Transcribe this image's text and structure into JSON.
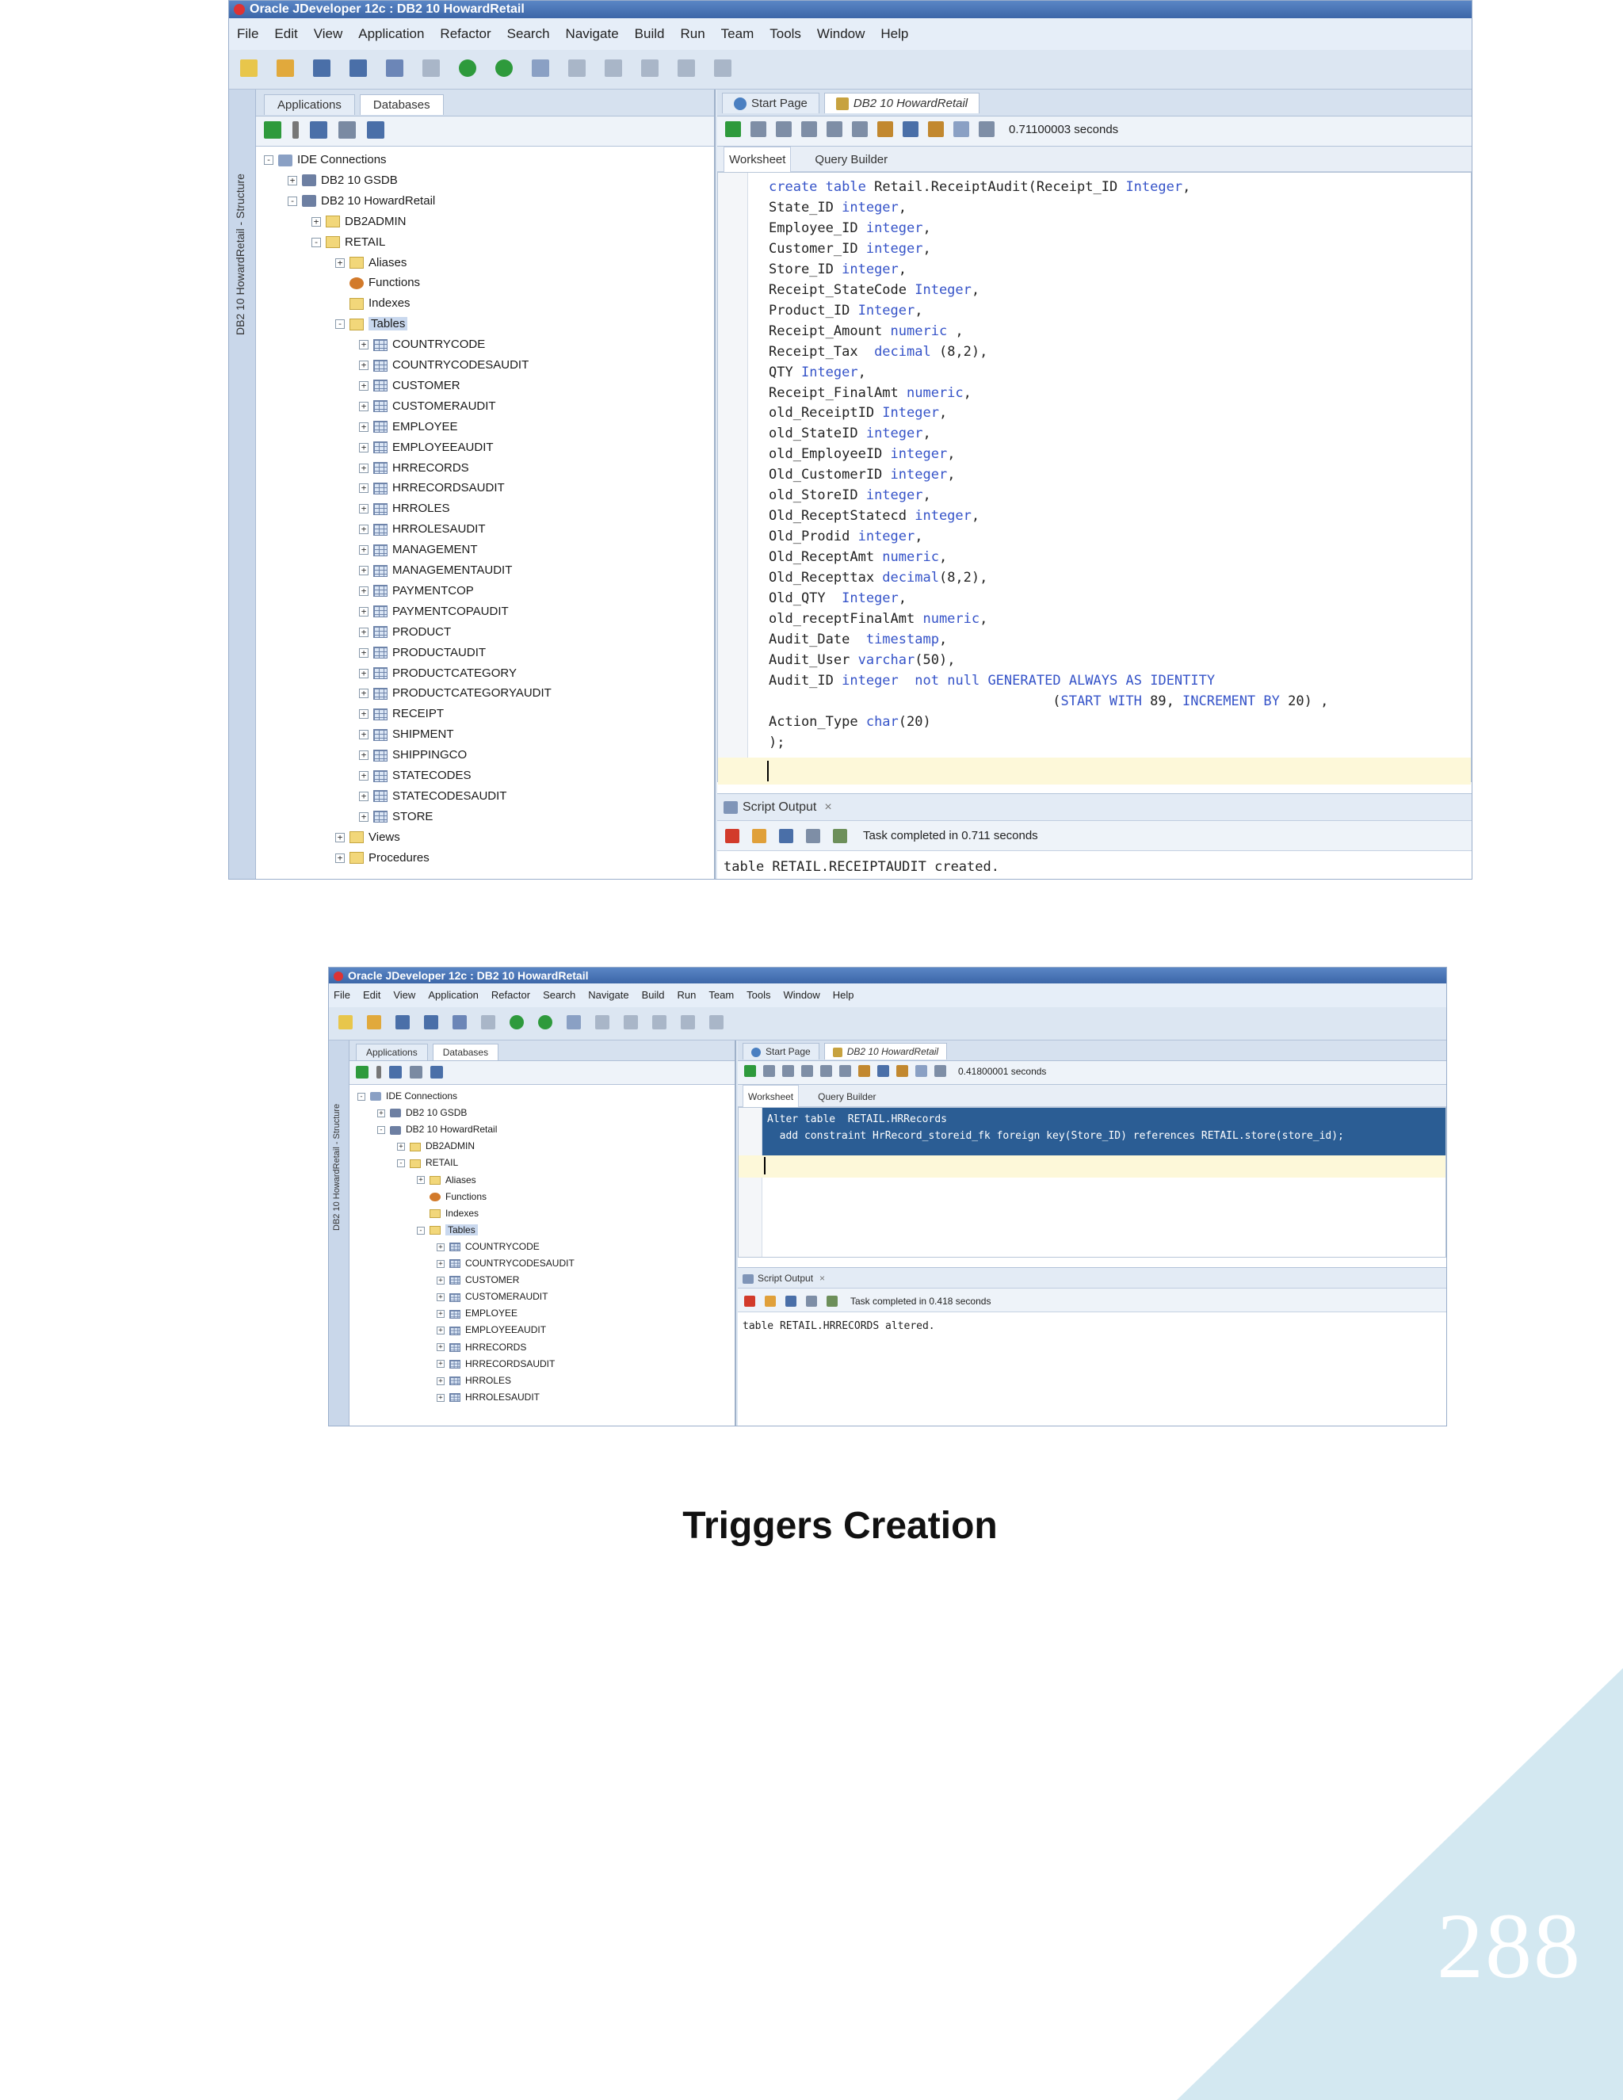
{
  "page": {
    "caption": "Triggers Creation",
    "page_number": "288",
    "corner_color": "#d3e8f1"
  },
  "shot1": {
    "title": "Oracle JDeveloper 12c : DB2 10 HowardRetail",
    "menu": [
      "File",
      "Edit",
      "View",
      "Application",
      "Refactor",
      "Search",
      "Navigate",
      "Build",
      "Run",
      "Team",
      "Tools",
      "Window",
      "Help"
    ],
    "left_tabs": [
      "Applications",
      "Databases"
    ],
    "structure_label": "DB2 10 HowardRetail - Structure",
    "tree": [
      {
        "label": "IDE Connections",
        "level": 0,
        "icon": "conn",
        "expander": "-"
      },
      {
        "label": "DB2 10 GSDB",
        "level": 1,
        "icon": "db",
        "expander": "+"
      },
      {
        "label": "DB2 10 HowardRetail",
        "level": 1,
        "icon": "db",
        "expander": "-"
      },
      {
        "label": "DB2ADMIN",
        "level": 2,
        "icon": "folder",
        "expander": "+"
      },
      {
        "label": "RETAIL",
        "level": 2,
        "icon": "folder",
        "expander": "-"
      },
      {
        "label": "Aliases",
        "level": 3,
        "icon": "folder",
        "expander": "+"
      },
      {
        "label": "Functions",
        "level": 3,
        "icon": "func",
        "expander": ""
      },
      {
        "label": "Indexes",
        "level": 3,
        "icon": "folder",
        "expander": ""
      },
      {
        "label": "Tables",
        "level": 3,
        "icon": "folder",
        "expander": "-",
        "selected": true
      },
      {
        "label": "COUNTRYCODE",
        "level": 4,
        "icon": "table",
        "expander": "+"
      },
      {
        "label": "COUNTRYCODESAUDIT",
        "level": 4,
        "icon": "table",
        "expander": "+"
      },
      {
        "label": "CUSTOMER",
        "level": 4,
        "icon": "table",
        "expander": "+"
      },
      {
        "label": "CUSTOMERAUDIT",
        "level": 4,
        "icon": "table",
        "expander": "+"
      },
      {
        "label": "EMPLOYEE",
        "level": 4,
        "icon": "table",
        "expander": "+"
      },
      {
        "label": "EMPLOYEEAUDIT",
        "level": 4,
        "icon": "table",
        "expander": "+"
      },
      {
        "label": "HRRECORDS",
        "level": 4,
        "icon": "table",
        "expander": "+"
      },
      {
        "label": "HRRECORDSAUDIT",
        "level": 4,
        "icon": "table",
        "expander": "+"
      },
      {
        "label": "HRROLES",
        "level": 4,
        "icon": "table",
        "expander": "+"
      },
      {
        "label": "HRROLESAUDIT",
        "level": 4,
        "icon": "table",
        "expander": "+"
      },
      {
        "label": "MANAGEMENT",
        "level": 4,
        "icon": "table",
        "expander": "+"
      },
      {
        "label": "MANAGEMENTAUDIT",
        "level": 4,
        "icon": "table",
        "expander": "+"
      },
      {
        "label": "PAYMENTCOP",
        "level": 4,
        "icon": "table",
        "expander": "+"
      },
      {
        "label": "PAYMENTCOPAUDIT",
        "level": 4,
        "icon": "table",
        "expander": "+"
      },
      {
        "label": "PRODUCT",
        "level": 4,
        "icon": "table",
        "expander": "+"
      },
      {
        "label": "PRODUCTAUDIT",
        "level": 4,
        "icon": "table",
        "expander": "+"
      },
      {
        "label": "PRODUCTCATEGORY",
        "level": 4,
        "icon": "table",
        "expander": "+"
      },
      {
        "label": "PRODUCTCATEGORYAUDIT",
        "level": 4,
        "icon": "table",
        "expander": "+"
      },
      {
        "label": "RECEIPT",
        "level": 4,
        "icon": "table",
        "expander": "+"
      },
      {
        "label": "SHIPMENT",
        "level": 4,
        "icon": "table",
        "expander": "+"
      },
      {
        "label": "SHIPPINGCO",
        "level": 4,
        "icon": "table",
        "expander": "+"
      },
      {
        "label": "STATECODES",
        "level": 4,
        "icon": "table",
        "expander": "+"
      },
      {
        "label": "STATECODESAUDIT",
        "level": 4,
        "icon": "table",
        "expander": "+"
      },
      {
        "label": "STORE",
        "level": 4,
        "icon": "table",
        "expander": "+"
      },
      {
        "label": "Views",
        "level": 3,
        "icon": "folder",
        "expander": "+"
      },
      {
        "label": "Procedures",
        "level": 3,
        "icon": "folder",
        "expander": "+"
      }
    ],
    "doc_tabs": [
      "Start Page",
      "DB2 10 HowardRetail"
    ],
    "exec_time": "0.71100003 seconds",
    "sub_tabs": [
      "Worksheet",
      "Query Builder"
    ],
    "code_lines": [
      "create table Retail.ReceiptAudit(Receipt_ID Integer,",
      "State_ID integer,",
      "Employee_ID integer,",
      "Customer_ID integer,",
      "Store_ID integer,",
      "Receipt_StateCode Integer,",
      "Product_ID Integer,",
      "Receipt_Amount numeric ,",
      "Receipt_Tax  decimal (8,2),",
      "QTY Integer,",
      "Receipt_FinalAmt numeric,",
      "old_ReceiptID Integer,",
      "old_StateID integer,",
      "old_EmployeeID integer,",
      "Old_CustomerID integer,",
      "old_StoreID integer,",
      "Old_ReceptStatecd integer,",
      "Old_Prodid integer,",
      "Old_ReceptAmt numeric,",
      "Old_Recepttax decimal(8,2),",
      "Old_QTY  Integer,",
      "old_receptFinalAmt numeric,",
      "Audit_Date  timestamp,",
      "Audit_User varchar(50),",
      "Audit_ID integer  not null GENERATED ALWAYS AS IDENTITY",
      "                                   (START WITH 89, INCREMENT BY 20) ,",
      "Action_Type char(20)",
      ");"
    ],
    "output_tab": "Script Output",
    "task_status": "Task completed in 0.711 seconds",
    "output_text": "table RETAIL.RECEIPTAUDIT created."
  },
  "shot2": {
    "title": "Oracle JDeveloper 12c : DB2 10 HowardRetail",
    "menu": [
      "File",
      "Edit",
      "View",
      "Application",
      "Refactor",
      "Search",
      "Navigate",
      "Build",
      "Run",
      "Team",
      "Tools",
      "Window",
      "Help"
    ],
    "left_tabs": [
      "Applications",
      "Databases"
    ],
    "structure_label": "DB2 10 HowardRetail - Structure",
    "tree": [
      {
        "label": "IDE Connections",
        "level": 0,
        "icon": "conn",
        "expander": "-"
      },
      {
        "label": "DB2 10 GSDB",
        "level": 1,
        "icon": "db",
        "expander": "+"
      },
      {
        "label": "DB2 10 HowardRetail",
        "level": 1,
        "icon": "db",
        "expander": "-"
      },
      {
        "label": "DB2ADMIN",
        "level": 2,
        "icon": "folder",
        "expander": "+"
      },
      {
        "label": "RETAIL",
        "level": 2,
        "icon": "folder",
        "expander": "-"
      },
      {
        "label": "Aliases",
        "level": 3,
        "icon": "folder",
        "expander": "+"
      },
      {
        "label": "Functions",
        "level": 3,
        "icon": "func",
        "expander": ""
      },
      {
        "label": "Indexes",
        "level": 3,
        "icon": "folder",
        "expander": ""
      },
      {
        "label": "Tables",
        "level": 3,
        "icon": "folder",
        "expander": "-",
        "selected": true
      },
      {
        "label": "COUNTRYCODE",
        "level": 4,
        "icon": "table",
        "expander": "+"
      },
      {
        "label": "COUNTRYCODESAUDIT",
        "level": 4,
        "icon": "table",
        "expander": "+"
      },
      {
        "label": "CUSTOMER",
        "level": 4,
        "icon": "table",
        "expander": "+"
      },
      {
        "label": "CUSTOMERAUDIT",
        "level": 4,
        "icon": "table",
        "expander": "+"
      },
      {
        "label": "EMPLOYEE",
        "level": 4,
        "icon": "table",
        "expander": "+"
      },
      {
        "label": "EMPLOYEEAUDIT",
        "level": 4,
        "icon": "table",
        "expander": "+"
      },
      {
        "label": "HRRECORDS",
        "level": 4,
        "icon": "table",
        "expander": "+"
      },
      {
        "label": "HRRECORDSAUDIT",
        "level": 4,
        "icon": "table",
        "expander": "+"
      },
      {
        "label": "HRROLES",
        "level": 4,
        "icon": "table",
        "expander": "+"
      },
      {
        "label": "HRROLESAUDIT",
        "level": 4,
        "icon": "table",
        "expander": "+"
      }
    ],
    "doc_tabs": [
      "Start Page",
      "DB2 10 HowardRetail"
    ],
    "exec_time": "0.41800001 seconds",
    "sub_tabs": [
      "Worksheet",
      "Query Builder"
    ],
    "code_lines": [
      "Alter table  RETAIL.HRRecords",
      "  add constraint HrRecord_storeid_fk foreign key(Store_ID) references RETAIL.store(store_id);"
    ],
    "output_tab": "Script Output",
    "task_status": "Task completed in 0.418 seconds",
    "output_text": "table RETAIL.HRRECORDS altered."
  }
}
